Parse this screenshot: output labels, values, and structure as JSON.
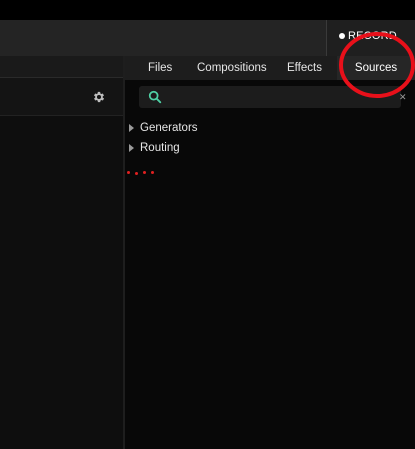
{
  "header": {
    "record_label": "RECORD"
  },
  "browser": {
    "tabs": [
      {
        "label": "Files"
      },
      {
        "label": "Compositions"
      },
      {
        "label": "Effects"
      },
      {
        "label": "Sources",
        "active": true
      }
    ],
    "search": {
      "value": "",
      "placeholder": "",
      "clear_glyph": "✕"
    },
    "tree": [
      {
        "label": "Generators",
        "expanded": false
      },
      {
        "label": "Routing",
        "expanded": false
      }
    ]
  },
  "icons": {
    "settings": "gear-icon",
    "search": "search-icon",
    "record": "record-dot-icon",
    "expand": "triangle-right-icon"
  },
  "colors": {
    "background": "#000000",
    "panel": "#0e0e0e",
    "toolbar": "#242424",
    "search_accent": "#4fd1a5",
    "annotation": "#e8101a",
    "text": "#e6e6e6"
  }
}
